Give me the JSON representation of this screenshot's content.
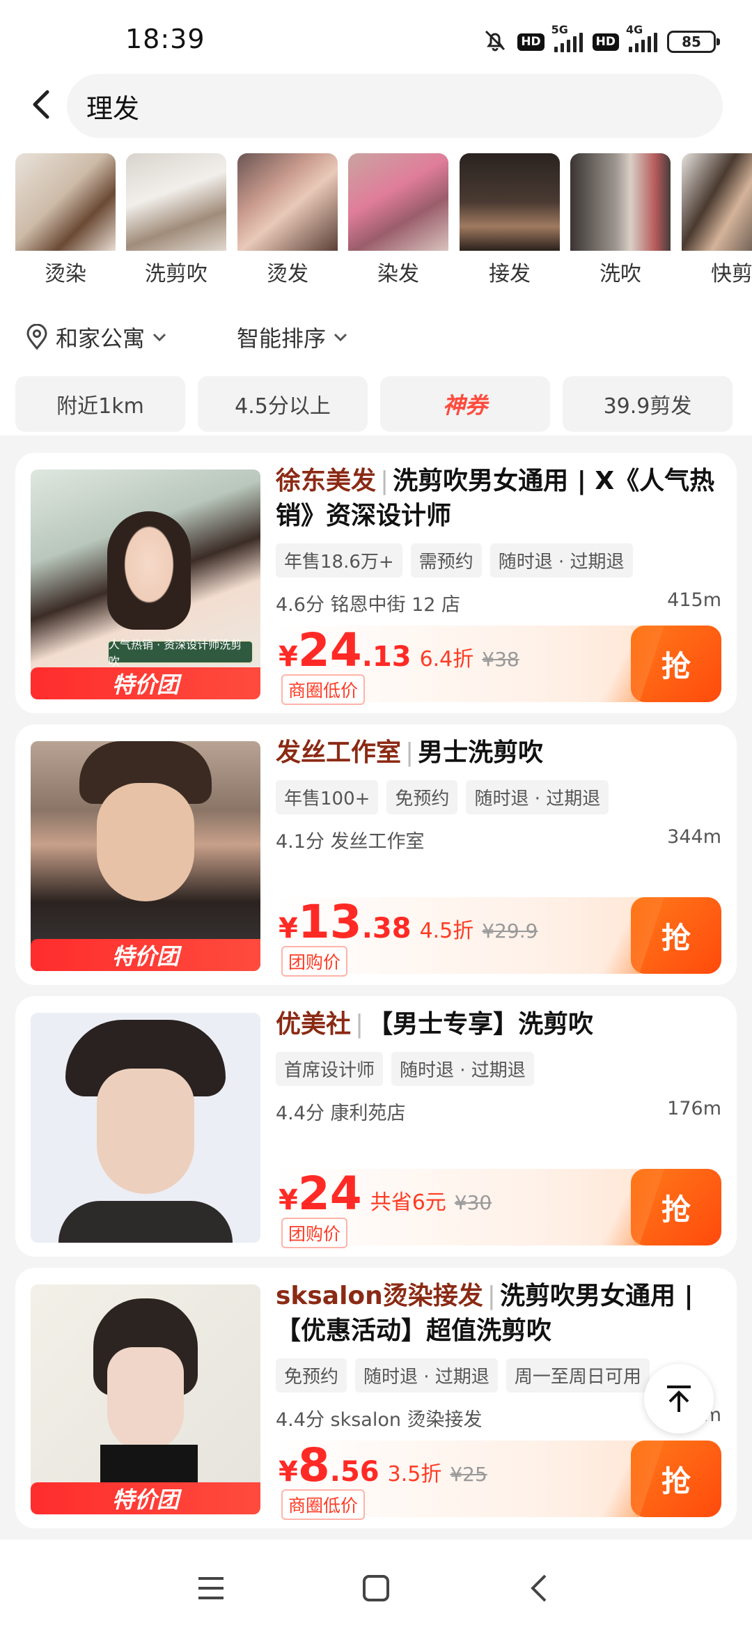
{
  "status": {
    "time": "18:39",
    "battery": "85",
    "net1": "5G",
    "net2": "4G",
    "hd": "HD"
  },
  "search": {
    "query": "理发"
  },
  "categories": [
    "烫染",
    "洗剪吹",
    "烫发",
    "染发",
    "接发",
    "洗吹",
    "快剪"
  ],
  "location": "和家公寓",
  "sort_label": "智能排序",
  "filters": [
    "附近1km",
    "4.5分以上",
    "神券",
    "39.9剪发"
  ],
  "cards": [
    {
      "shop": "徐东美发",
      "title": "洗剪吹男女通用 | X《人气热销》资深设计师",
      "tags": [
        "年售18.6万+",
        "需预约",
        "随时退 · 过期退"
      ],
      "rating_branch": "4.6分 铭恩中街 12 店",
      "distance": "415m",
      "price_int": "24",
      "price_dec": ".13",
      "discount": "6.4折",
      "original": "¥38",
      "price_tag": "商圈低价",
      "thumb_badge": "特价团",
      "thumb_caption": "人气热销 · 资深设计师洗剪吹"
    },
    {
      "shop": "发丝工作室",
      "title": "男士洗剪吹",
      "tags": [
        "年售100+",
        "免预约",
        "随时退 · 过期退"
      ],
      "rating_branch": "4.1分 发丝工作室",
      "distance": "344m",
      "price_int": "13",
      "price_dec": ".38",
      "discount": "4.5折",
      "original": "¥29.9",
      "price_tag": "团购价",
      "thumb_badge": "特价团"
    },
    {
      "shop": "优美社",
      "title": "【男士专享】洗剪吹",
      "tags": [
        "首席设计师",
        "随时退 · 过期退"
      ],
      "rating_branch": "4.4分 康利苑店",
      "distance": "176m",
      "price_int": "24",
      "price_dec": "",
      "discount": "共省6元",
      "original": "¥30",
      "price_tag": "团购价"
    },
    {
      "shop": "sksalon烫染接发",
      "title": "洗剪吹男女通用 | 【优惠活动】超值洗剪吹",
      "tags": [
        "免预约",
        "随时退 · 过期退",
        "周一至周日可用"
      ],
      "rating_branch": "4.4分 sksalon 烫染接发",
      "distance": "m",
      "price_int": "8",
      "price_dec": ".56",
      "discount": "3.5折",
      "original": "¥25",
      "price_tag": "商圈低价",
      "thumb_badge": "特价团"
    }
  ],
  "grab_label": "抢",
  "colors": {
    "accent": "#ff2a25",
    "grab": "#ff5a12",
    "shop": "#8b2a14"
  }
}
